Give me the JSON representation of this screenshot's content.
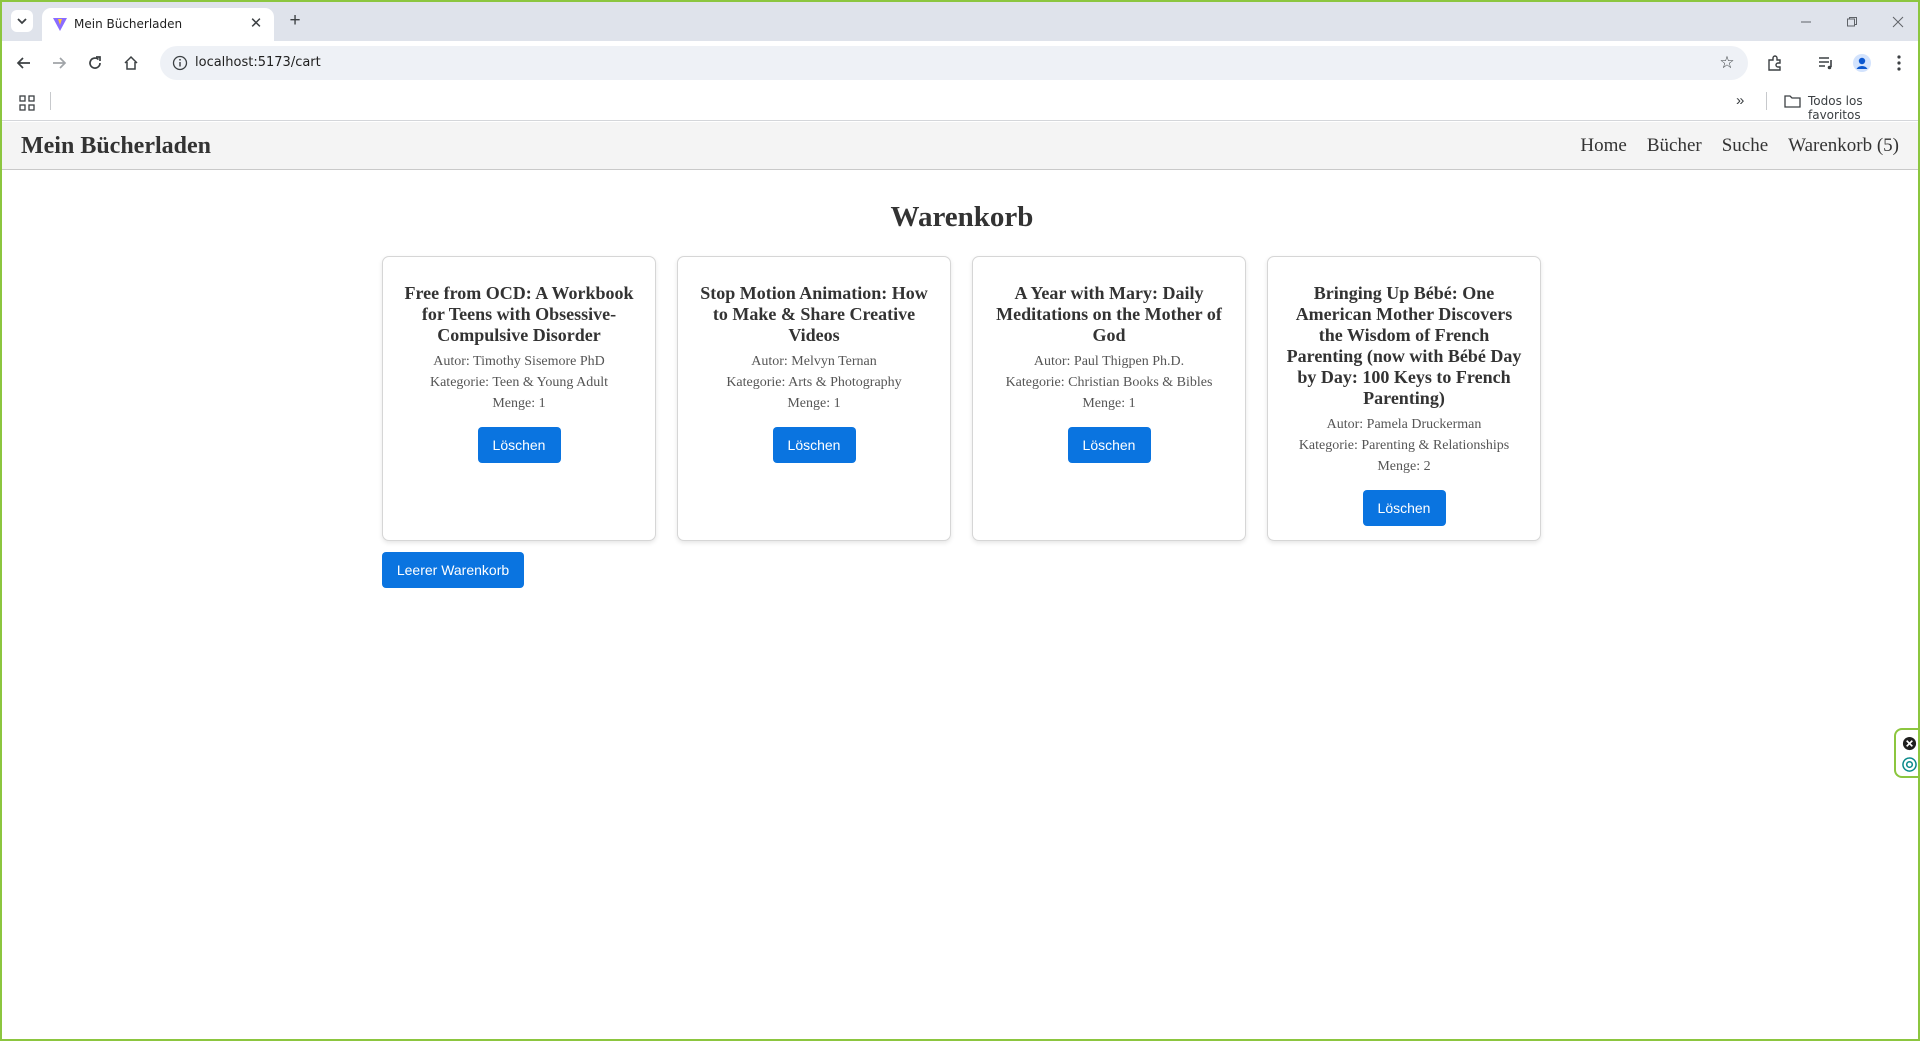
{
  "browser": {
    "tab_title": "Mein Bücherladen",
    "url": "localhost:5173/cart",
    "bookmarks_folder_label": "Todos los favoritos",
    "icons": {
      "tab_search": "chevron-down-icon",
      "favicon": "vite-favicon-icon",
      "close_tab": "close-icon",
      "new_tab": "plus-icon",
      "back": "back-arrow-icon",
      "forward": "forward-arrow-icon",
      "reload": "reload-icon",
      "home": "home-icon",
      "site_info": "info-icon",
      "bookmark": "star-icon",
      "extensions": "puzzle-icon",
      "media": "media-icon",
      "profile": "profile-icon",
      "menu": "kebab-menu-icon",
      "apps": "apps-grid-icon",
      "more_bookmarks": "chevrons-right-icon",
      "folder": "folder-icon"
    }
  },
  "site": {
    "brand": "Mein Bücherladen",
    "nav": {
      "home": "Home",
      "books": "Bücher",
      "search": "Suche",
      "cart": "Warenkorb (5)"
    }
  },
  "cart": {
    "title": "Warenkorb",
    "items": [
      {
        "title": "Free from OCD: A Workbook for Teens with Obsessive-Compulsive Disorder",
        "author": "Autor: Timothy Sisemore PhD",
        "category": "Kategorie: Teen & Young Adult",
        "quantity": "Menge: 1",
        "delete_label": "Löschen"
      },
      {
        "title": "Stop Motion Animation: How to Make & Share Creative Videos",
        "author": "Autor: Melvyn Ternan",
        "category": "Kategorie: Arts & Photography",
        "quantity": "Menge: 1",
        "delete_label": "Löschen"
      },
      {
        "title": "A Year with Mary: Daily Meditations on the Mother of God",
        "author": "Autor: Paul Thigpen Ph.D.",
        "category": "Kategorie: Christian Books & Bibles",
        "quantity": "Menge: 1",
        "delete_label": "Löschen"
      },
      {
        "title": "Bringing Up Bébé: One American Mother Discovers the Wisdom of French Parenting (now with Bébé Day by Day: 100 Keys to French Parenting)",
        "author": "Autor: Pamela Druckerman",
        "category": "Kategorie: Parenting & Relationships",
        "quantity": "Menge: 2",
        "delete_label": "Löschen"
      }
    ],
    "clear_label": "Leerer Warenkorb"
  },
  "colors": {
    "primary_button": "#0a74e0",
    "nav_background": "#f4f4f4",
    "window_frame": "#8cc63f"
  }
}
